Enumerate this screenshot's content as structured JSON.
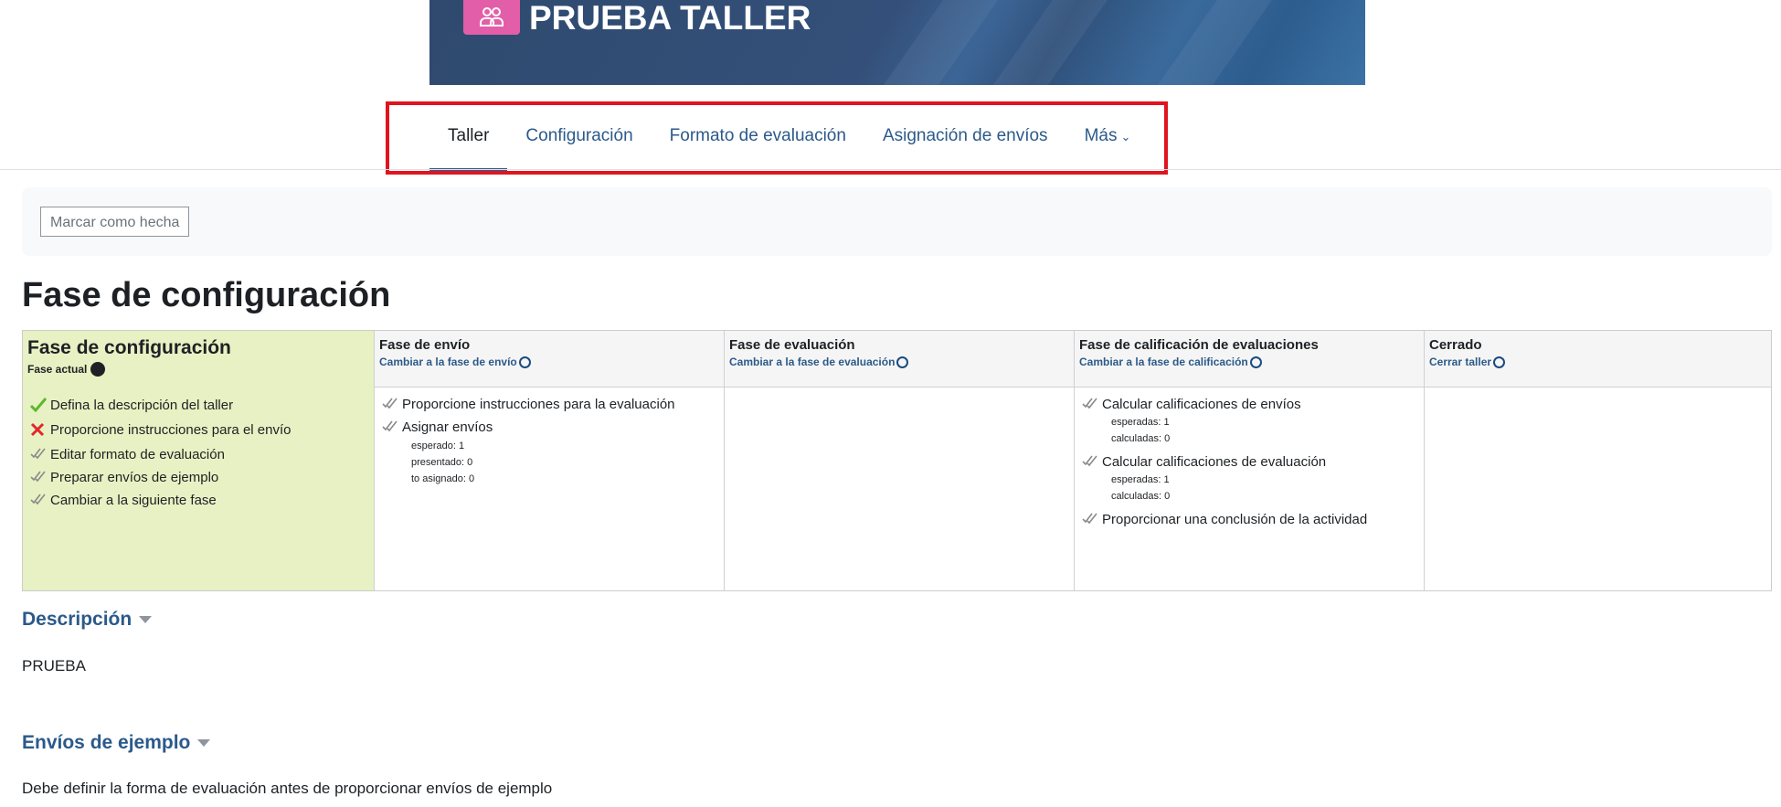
{
  "banner": {
    "title": "PRUEBA TALLER",
    "icon": "workshop-people-icon",
    "icon_color": "#e35ea8"
  },
  "nav": {
    "tabs": [
      {
        "label": "Taller",
        "active": true
      },
      {
        "label": "Configuración"
      },
      {
        "label": "Formato de evaluación"
      },
      {
        "label": "Asignación de envíos"
      },
      {
        "label": "Más"
      }
    ]
  },
  "completion": {
    "button_label": "Marcar como hecha"
  },
  "page_title": "Fase de configuración",
  "phases": {
    "setup": {
      "title": "Fase de configuración",
      "current_label": "Fase actual",
      "tasks": [
        {
          "label": "Defina la descripción del taller",
          "status": "done"
        },
        {
          "label": "Proporcione instrucciones para el envío",
          "status": "failed"
        },
        {
          "label": "Editar formato de evaluación",
          "status": "todo"
        },
        {
          "label": "Preparar envíos de ejemplo",
          "status": "todo"
        },
        {
          "label": "Cambiar a la siguiente fase",
          "status": "todo"
        }
      ]
    },
    "submission": {
      "title": "Fase de envío",
      "switch_label": "Cambiar a la fase de envío",
      "tasks": [
        {
          "label": "Proporcione instrucciones para la evaluación"
        },
        {
          "label": "Asignar envíos",
          "details": [
            "esperado: 1",
            "presentado: 0",
            "to asignado: 0"
          ]
        }
      ]
    },
    "assessment": {
      "title": "Fase de evaluación",
      "switch_label": "Cambiar a la fase de evaluación"
    },
    "evaluation": {
      "title": "Fase de calificación de evaluaciones",
      "switch_label": "Cambiar a la fase de calificación",
      "tasks": [
        {
          "label": "Calcular calificaciones de envíos",
          "details": [
            "esperadas: 1",
            "calculadas: 0"
          ]
        },
        {
          "label": "Calcular calificaciones de evaluación",
          "details": [
            "esperadas: 1",
            "calculadas: 0"
          ]
        },
        {
          "label": "Proporcionar una conclusión de la actividad"
        }
      ]
    },
    "closed": {
      "title": "Cerrado",
      "switch_label": "Cerrar taller"
    }
  },
  "description": {
    "title": "Descripción",
    "text": "PRUEBA"
  },
  "examples": {
    "title": "Envíos de ejemplo",
    "text": "Debe definir la forma de evaluación antes de proporcionar envíos de ejemplo"
  }
}
